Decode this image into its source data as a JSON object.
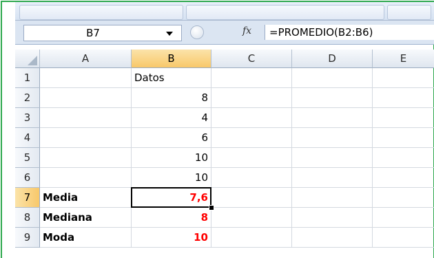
{
  "namebox": {
    "value": "B7"
  },
  "formula_bar": {
    "fx_label": "fx",
    "formula": "=PROMEDIO(B2:B6)"
  },
  "columns": [
    "A",
    "B",
    "C",
    "D",
    "E"
  ],
  "active": {
    "column": "B",
    "row": "7"
  },
  "rows": [
    {
      "num": "1",
      "a": "",
      "b": "Datos",
      "b_style": "text"
    },
    {
      "num": "2",
      "a": "",
      "b": "8",
      "b_style": "num"
    },
    {
      "num": "3",
      "a": "",
      "b": "4",
      "b_style": "num"
    },
    {
      "num": "4",
      "a": "",
      "b": "6",
      "b_style": "num"
    },
    {
      "num": "5",
      "a": "",
      "b": "10",
      "b_style": "num"
    },
    {
      "num": "6",
      "a": "",
      "b": "10",
      "b_style": "num"
    },
    {
      "num": "7",
      "a": "Media",
      "b": "7,6",
      "b_style": "result"
    },
    {
      "num": "8",
      "a": "Mediana",
      "b": "8",
      "b_style": "result"
    },
    {
      "num": "9",
      "a": "Moda",
      "b": "10",
      "b_style": "result"
    }
  ],
  "colors": {
    "result_text": "#ff0000",
    "header_active": "#f8c86a",
    "frame_border": "#2fa84f"
  }
}
